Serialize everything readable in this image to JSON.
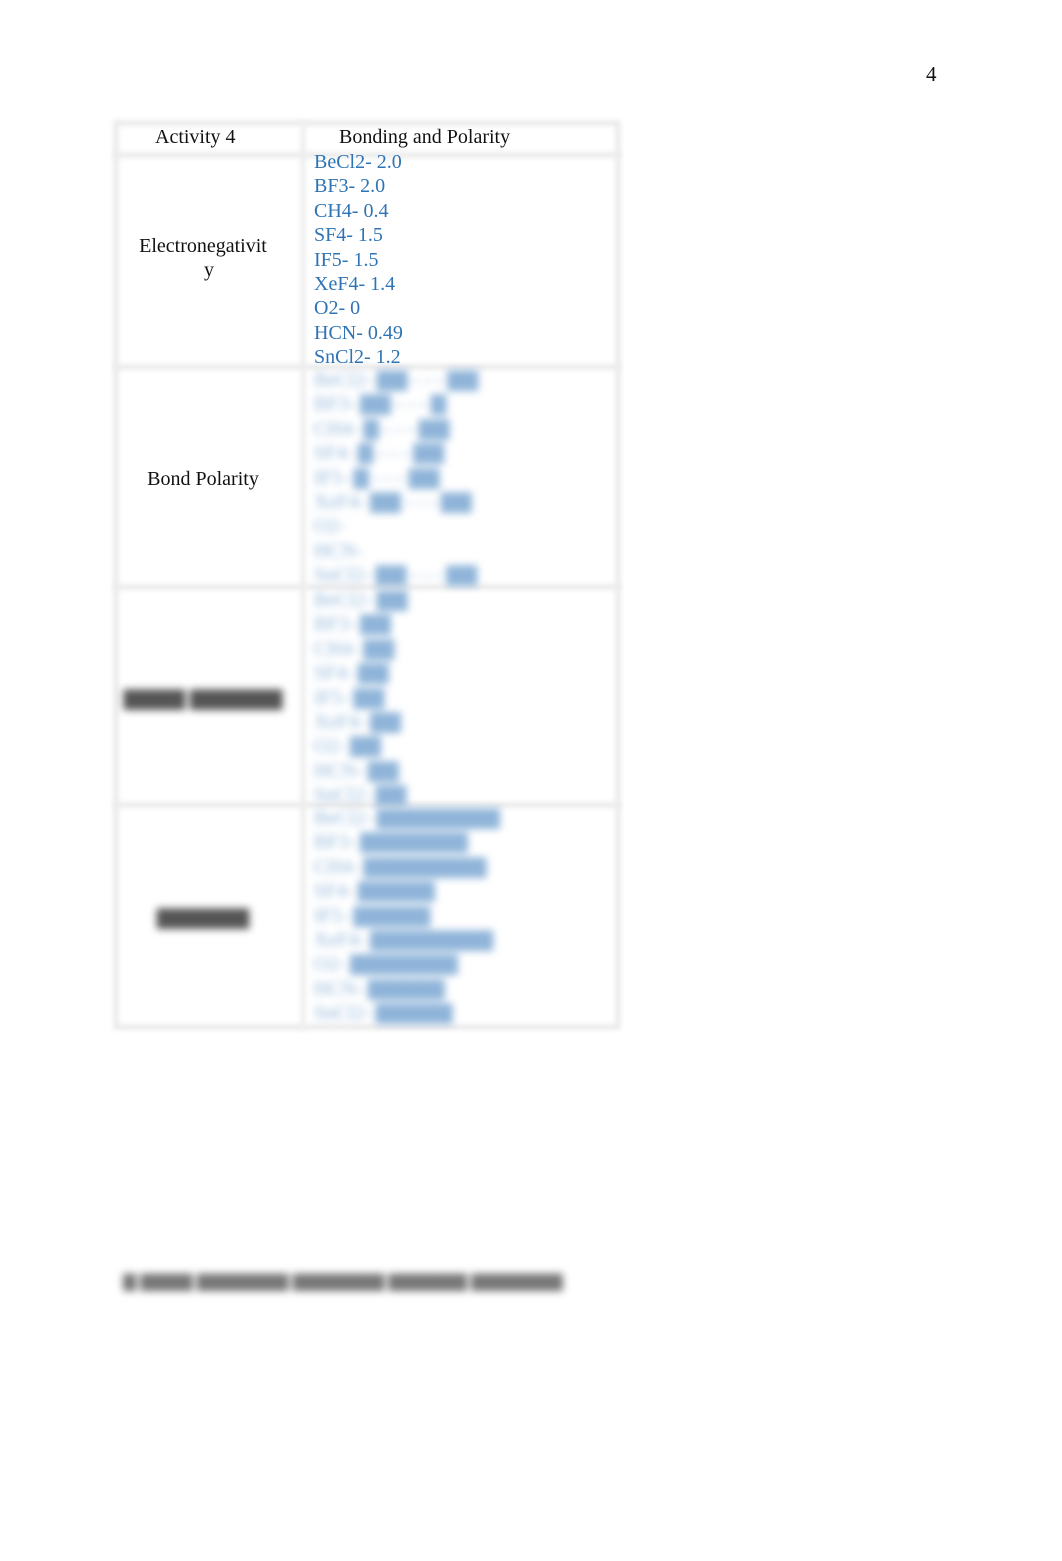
{
  "page": {
    "number": "4"
  },
  "table": {
    "header": {
      "left": "Activity 4",
      "right": "Bonding and Polarity"
    },
    "rows": [
      {
        "label": "Electronegativit",
        "label_wrap": "y",
        "values": [
          "BeCl2- 2.0",
          "BF3- 2.0",
          "CH4- 0.4",
          "SF4- 1.5",
          "IF5- 1.5",
          "XeF4- 1.4",
          "O2- 0",
          "HCN- 0.49",
          "SnCl2- 1.2"
        ]
      },
      {
        "label": "Bond Polarity",
        "values_obscured": true,
        "values": [
          "BeCl2- ▇▇ - - - ▇▇",
          "BF3- ▇▇ - - - ▇",
          "CH4- ▇ - - - ▇▇",
          "SF4- ▇ - - - ▇▇",
          "IF5- ▇ - - - ▇▇",
          "XeF4- ▇▇ - - - ▇▇",
          "O2-",
          "HCN-",
          "SnCl2- ▇▇ - - - ▇▇"
        ]
      },
      {
        "label": "▇▇▇▇ ▇▇▇▇▇▇",
        "label_obscured": true,
        "values_obscured": true,
        "values": [
          "BeCl2- ▇▇",
          "BF3- ▇▇",
          "CH4- ▇▇",
          "SF4- ▇▇",
          "IF5- ▇▇",
          "XeF4- ▇▇",
          "O2- ▇▇",
          "HCN- ▇▇",
          "SnCl2- ▇▇"
        ]
      },
      {
        "label": "▇▇▇▇▇▇",
        "label_obscured": true,
        "values_obscured": true,
        "values": [
          "BeCl2- ▇▇▇▇▇▇▇▇",
          "BF3- ▇▇▇▇▇▇▇",
          "CH4- ▇▇▇▇▇▇▇▇",
          "SF4- ▇▇▇▇▇",
          "IF5- ▇▇▇▇▇",
          "XeF4- ▇▇▇▇▇▇▇▇",
          "O2- ▇▇▇▇▇▇▇",
          "HCN- ▇▇▇▇▇",
          "SnCl2- ▇▇▇▇▇"
        ]
      }
    ]
  },
  "footer": {
    "text": "▇ ▇▇▇▇ ▇▇▇▇▇▇▇ ▇▇▇▇▇▇▇ ▇▇▇▇▇▇ ▇▇▇▇▇▇▇"
  },
  "colors": {
    "value_text": "#2e74b5",
    "border": "#ececec"
  }
}
